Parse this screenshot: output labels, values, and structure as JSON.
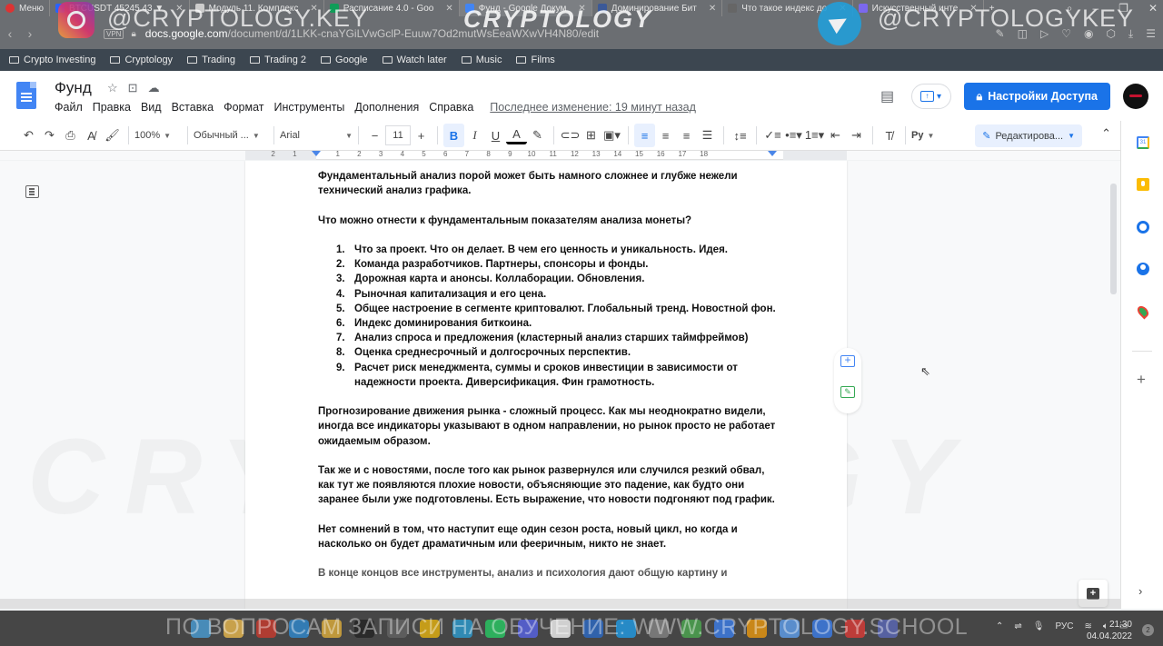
{
  "browser": {
    "menu_label": "Меню",
    "tabs": [
      {
        "label": "BTCUSDT 45245.43 ▼",
        "favicon_color": "#2962ff"
      },
      {
        "label": "Модуль 11. Комплекс",
        "favicon_color": "#cccccc"
      },
      {
        "label": "Расписание 4.0 - Goo",
        "favicon_color": "#0f9d58"
      },
      {
        "label": "Фунд - Google Докум",
        "favicon_color": "#4285f4",
        "active": true
      },
      {
        "label": "Доминирование Бит",
        "favicon_color": "#3b5998"
      },
      {
        "label": "Что такое индекс до",
        "favicon_color": "#666666"
      },
      {
        "label": "Искусственный инте",
        "favicon_color": "#7b68ee"
      }
    ],
    "tab_close_glyph": "✕",
    "new_tab_glyph": "+",
    "url_domain": "docs.google.com",
    "url_path": "/document/d/1LKK-cnaYGiLVwGclP-Euuw7Od2mutWsEeaWXwVH4N80/edit",
    "vpn_label": "VPN",
    "bookmarks": [
      "Crypto Investing",
      "Cryptology",
      "Trading",
      "Trading 2",
      "Google",
      "Watch later",
      "Music",
      "Films"
    ]
  },
  "docs": {
    "title": "Фунд",
    "menu": [
      "Файл",
      "Правка",
      "Вид",
      "Вставка",
      "Формат",
      "Инструменты",
      "Дополнения",
      "Справка"
    ],
    "last_edit": "Последнее изменение: 19 минут назад",
    "share_label": "Настройки Доступа",
    "accent_color": "#1a73e8"
  },
  "toolbar": {
    "zoom": "100%",
    "style": "Обычный ...",
    "font": "Arial",
    "font_size": "11",
    "edit_mode": "Редактирова...",
    "spellcheck_label": "Ру"
  },
  "ruler": {
    "ticks": [
      "2",
      "1",
      "1",
      "2",
      "3",
      "4",
      "5",
      "6",
      "7",
      "8",
      "9",
      "10",
      "11",
      "12",
      "13",
      "14",
      "15",
      "16",
      "17",
      "18"
    ]
  },
  "document": {
    "intro": "Фундаментальный анализ порой может быть намного сложнее и глубже нежели технический анализ графика.",
    "question": "Что можно отнести к фундаментальным показателям анализа монеты?",
    "list": [
      {
        "num": "1.",
        "text": "Что за проект. Что он делает. В чем его ценность и уникальность. Идея."
      },
      {
        "num": "2.",
        "text": "Команда разработчиков. Партнеры, спонсоры и фонды."
      },
      {
        "num": "3.",
        "text": "Дорожная карта и анонсы. Коллаборации. Обновления."
      },
      {
        "num": "4.",
        "text": "Рыночная капитализация и его цена."
      },
      {
        "num": "5.",
        "text": "Общее настроение в сегменте криптовалют. Глобальный тренд. Новостной фон."
      },
      {
        "num": "6.",
        "text": "Индекс доминирования биткоина."
      },
      {
        "num": "7.",
        "text": "Анализ спроса и предложения (кластерный анализ старших таймфреймов)"
      },
      {
        "num": "8.",
        "text": "Оценка среднесрочный и долгосрочных перспектив."
      },
      {
        "num": "9.",
        "text": "Расчет риск менеджмента, суммы и сроков инвестиции в зависимости от надежности проекта. Диверсификация. Фин грамотность."
      }
    ],
    "para_forecast": "Прогнозирование движения рынка - сложный процесс. Как мы неоднократно видели, иногда все индикаторы указывают в одном направлении, но рынок просто не работает ожидаемым образом.",
    "para_news": "Так же и с новостями, после того как рынок развернулся или случился резкий обвал, как тут же появляются плохие новости, объясняющие это падение, как будто они заранее были уже подготовлены. Есть выражение, что новости подгоняют под график.",
    "para_cycle": "Нет сомнений в том, что наступит еще один сезон роста, новый цикл, но когда и насколько он будет драматичным или фееричным, никто не знает.",
    "para_end": "В конце концов все инструменты, анализ и психология дают общую картину и"
  },
  "side_panel": {
    "calendar_day": "31"
  },
  "taskbar": {
    "language": "РУС",
    "time": "21:30",
    "date": "04.04.2022",
    "notifications": "2",
    "icon_colors": [
      "#4aa3df",
      "#f4c04e",
      "#d33a2c",
      "#2d8ed8",
      "#e8b43a",
      "#222222",
      "#666666",
      "#f0b90b",
      "#2aa1da",
      "#25d366",
      "#5865f2",
      "#ffffff",
      "#2a6ccf",
      "#1da1f2",
      "#888888",
      "#4caf50",
      "#3b82f6",
      "#f59e0b",
      "#60a5fa",
      "#3b82f6",
      "#e53935",
      "#5c6bc0"
    ]
  },
  "watermarks": {
    "instagram_handle": "@CRYPTOLOGY.KEY",
    "telegram_handle": "@CRYPTOLOGYKEY",
    "logo": "CRYPTOLOGY",
    "big_logo": "CRYPTOLOGY",
    "bottom_banner": "ПО ВОПРОСАМ ЗАПИСИ НА ОБУЧЕНИЕ: WWW.CRYPTOLOGY.SCHOOL"
  }
}
